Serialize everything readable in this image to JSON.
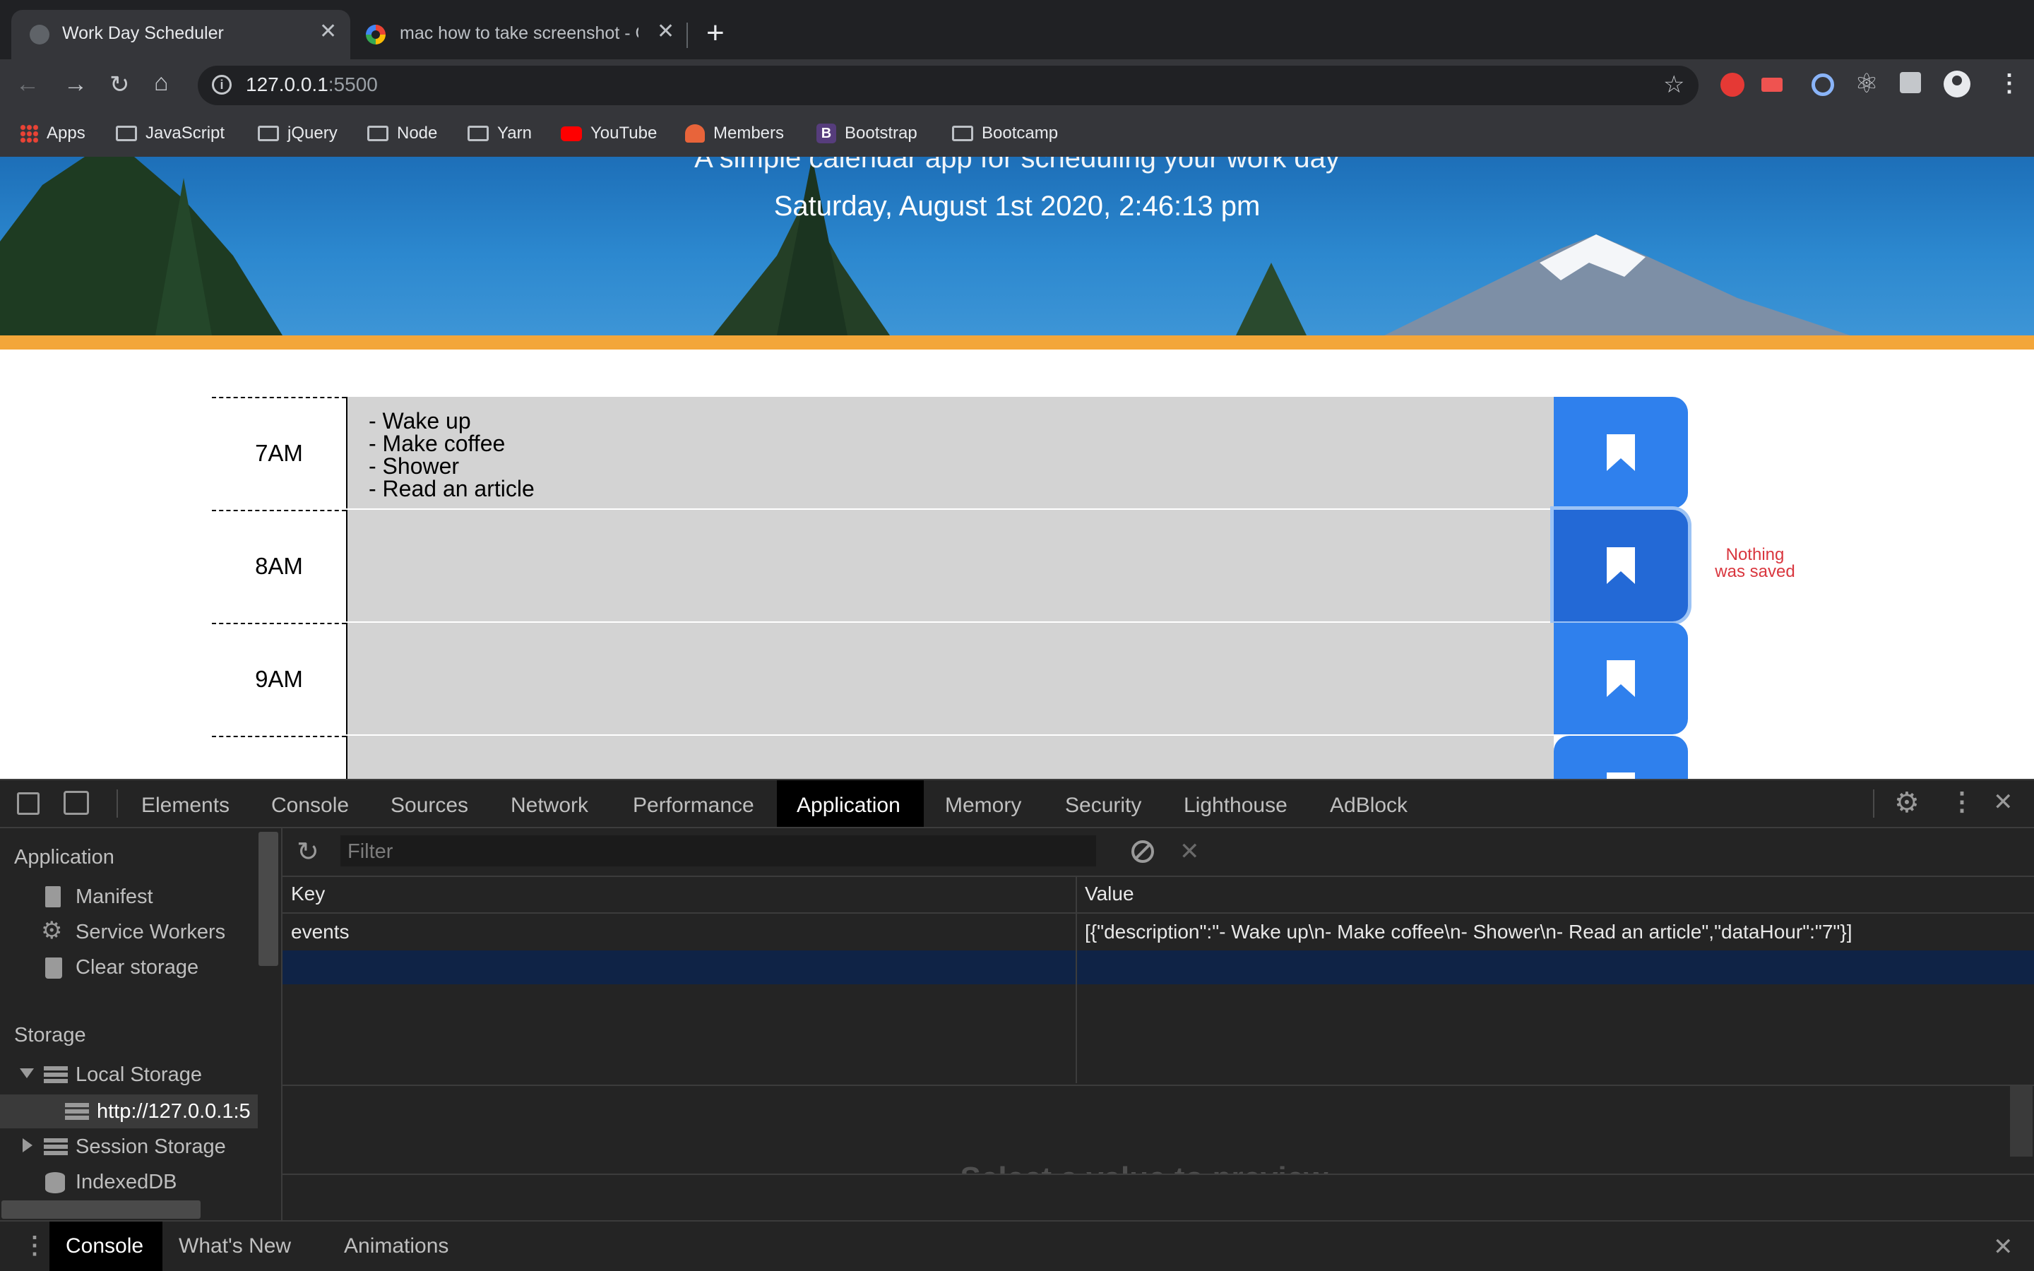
{
  "browser": {
    "tabs": [
      {
        "title": "Work Day Scheduler"
      },
      {
        "title": "mac how to take screenshot - G"
      }
    ],
    "address": {
      "host": "127.0.0.1",
      "port": ":5500"
    },
    "bookmarks": [
      "Apps",
      "JavaScript",
      "jQuery",
      "Node",
      "Yarn",
      "YouTube",
      "Members",
      "Bootstrap",
      "Bootcamp"
    ]
  },
  "page": {
    "subtitle": "A simple calendar app for scheduling your work day",
    "datetime": "Saturday, August 1st 2020, 2:46:13 pm",
    "hours": [
      {
        "label": "7AM",
        "lines": [
          "- Wake up",
          "- Make coffee",
          "- Shower",
          "- Read an article"
        ]
      },
      {
        "label": "8AM",
        "lines": []
      },
      {
        "label": "9AM",
        "lines": []
      }
    ],
    "save_message_line1": "Nothing",
    "save_message_line2": "was saved"
  },
  "devtools": {
    "tabs": [
      "Elements",
      "Console",
      "Sources",
      "Network",
      "Performance",
      "Application",
      "Memory",
      "Security",
      "Lighthouse",
      "AdBlock"
    ],
    "active_tab": "Application",
    "sidebar": {
      "application_header": "Application",
      "application_items": [
        "Manifest",
        "Service Workers",
        "Clear storage"
      ],
      "storage_header": "Storage",
      "local_storage": "Local Storage",
      "local_storage_origin": "http://127.0.0.1:5",
      "session_storage": "Session Storage",
      "indexeddb": "IndexedDB"
    },
    "filter_placeholder": "Filter",
    "table": {
      "headers": [
        "Key",
        "Value"
      ],
      "rows": [
        {
          "key": "events",
          "value": "[{\"description\":\"- Wake up\\n- Make coffee\\n- Shower\\n- Read an article\",\"dataHour\":\"7\"}]"
        }
      ]
    },
    "preview_text": "Select a value to preview",
    "drawer_tabs": [
      "Console",
      "What's New",
      "Animations"
    ]
  },
  "colors": {
    "accent": "#2f80ed",
    "orange_bar": "#f3a63a",
    "error_text": "#d9363e"
  }
}
